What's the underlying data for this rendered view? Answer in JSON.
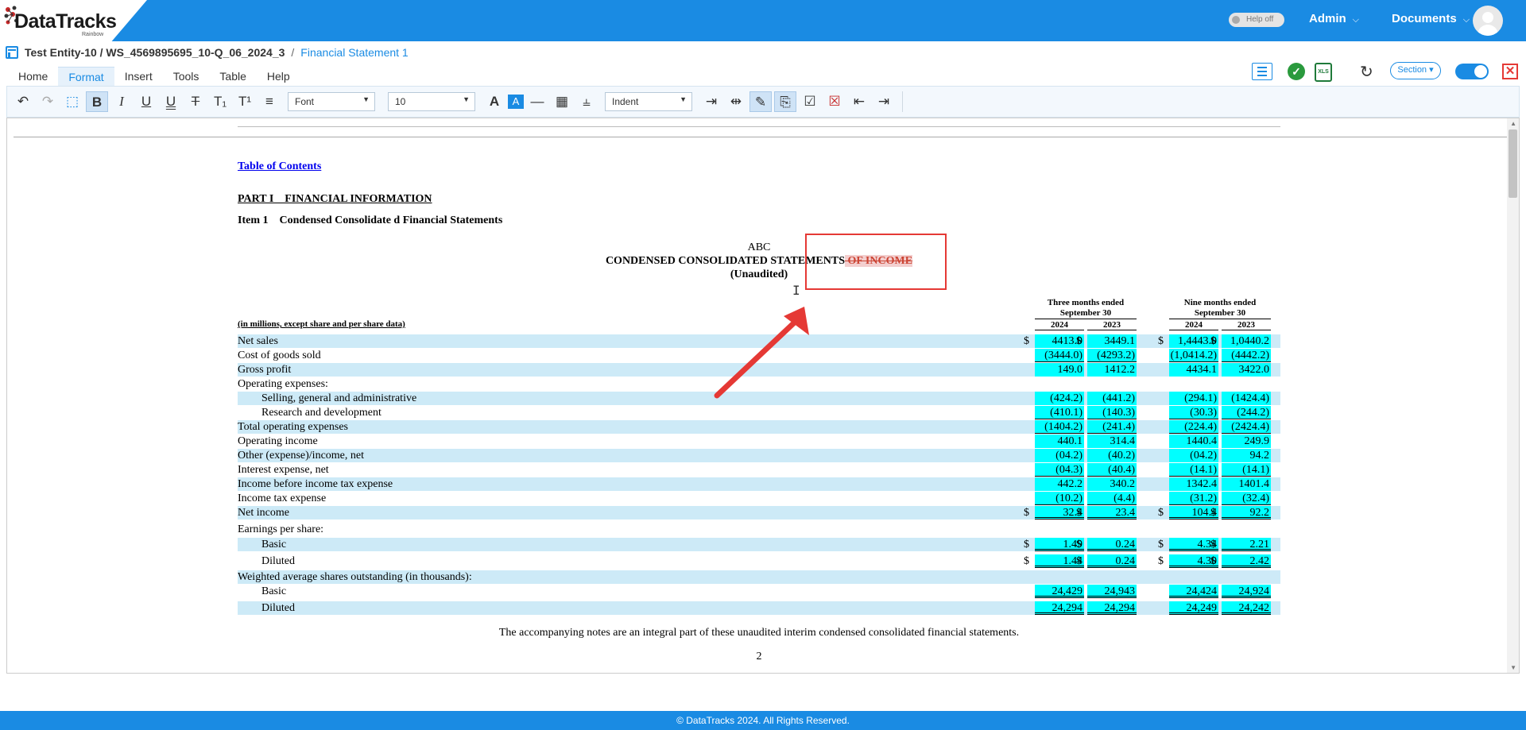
{
  "app": {
    "logo_text": "DataTracks",
    "logo_sub": "Rainbow",
    "help_toggle": "Help off",
    "nav": [
      {
        "label": "Admin"
      },
      {
        "label": "Documents"
      }
    ]
  },
  "breadcrumb": {
    "path": "Test Entity-10 / WS_4569895695_10-Q_06_2024_3",
    "separator": "/",
    "current": "Financial Statement 1"
  },
  "menu": [
    "Home",
    "Format",
    "Insert",
    "Tools",
    "Table",
    "Help"
  ],
  "menu_active": "Format",
  "header_controls": {
    "section_label": "Section",
    "xls_label": "XLS"
  },
  "toolbar": {
    "font_select": "Font",
    "size_select": "10",
    "indent_select": "Indent"
  },
  "document": {
    "toc_link": "Table of Contents",
    "part_heading": "PART I    FINANCIAL INFORMATION",
    "item_heading": "Item 1    Condensed Consolidate d Financial Statements",
    "company": "ABC",
    "title_main": "CONDENSED CONSOLIDATED STATEMENTS",
    "title_deleted": " OF INCOME",
    "title_sub": "(Unaudited)",
    "units_note": "(in millions, except share and per share data)",
    "col_groups": [
      "Three months ended September 30",
      "Nine months ended September 30"
    ],
    "years": [
      "2024",
      "2023",
      "2024",
      "2023"
    ],
    "rows": [
      {
        "label": "Net sales",
        "values": [
          "4413.0",
          "3449.1",
          "1,4443.0",
          "1,0440.2"
        ],
        "dollar": true,
        "hl": true
      },
      {
        "label": "Cost of goods sold",
        "values": [
          "(3444.0)",
          "(4293.2)",
          "(1,0414.2)",
          "(4442.2)"
        ],
        "ul": true
      },
      {
        "label": "Gross profit",
        "values": [
          "149.0",
          "1412.2",
          "4434.1",
          "3422.0"
        ],
        "hl": true
      },
      {
        "label": "Operating expenses:",
        "values": []
      },
      {
        "label": "Selling, general and administrative",
        "values": [
          "(424.2)",
          "(441.2)",
          "(294.1)",
          "(1424.4)"
        ],
        "indent": true,
        "hl": true
      },
      {
        "label": "Research and development",
        "values": [
          "(410.1)",
          "(140.3)",
          "(30.3)",
          "(244.2)"
        ],
        "indent": true,
        "ul": true
      },
      {
        "label": "Total operating expenses",
        "values": [
          "(1404.2)",
          "(241.4)",
          "(224.4)",
          "(2424.4)"
        ],
        "hl": true,
        "ul": true
      },
      {
        "label": "Operating income",
        "values": [
          "440.1",
          "314.4",
          "1440.4",
          "249.9"
        ]
      },
      {
        "label": "Other (expense)/income, net",
        "values": [
          "(04.2)",
          "(40.2)",
          "(04.2)",
          "94.2"
        ],
        "hl": true
      },
      {
        "label": "Interest expense, net",
        "values": [
          "(04.3)",
          "(40.4)",
          "(14.1)",
          "(14.1)"
        ],
        "ul": true
      },
      {
        "label": "Income before income tax expense",
        "values": [
          "442.2",
          "340.2",
          "1342.4",
          "1401.4"
        ],
        "hl": true
      },
      {
        "label": "Income tax expense",
        "values": [
          "(10.2)",
          "(4.4)",
          "(31.2)",
          "(32.4)"
        ],
        "ul": true
      },
      {
        "label": "Net income",
        "values": [
          "32.4",
          "23.4",
          "104.4",
          "92.2"
        ],
        "dollar": true,
        "dbl": true,
        "hl": true
      },
      {
        "label": "Earnings per share:",
        "values": []
      },
      {
        "label": "Basic",
        "values": [
          "1.49",
          "0.24",
          "4.34",
          "2.21"
        ],
        "indent": true,
        "dollar": true,
        "dbl": true,
        "hl": true
      },
      {
        "label": "Diluted",
        "values": [
          "1.44",
          "0.24",
          "4.30",
          "2.42"
        ],
        "indent": true,
        "dollar": true,
        "dbl": true
      },
      {
        "label": "Weighted average shares outstanding (in thousands):",
        "values": [],
        "hl": true
      },
      {
        "label": "Basic",
        "values": [
          "24,429",
          "24,943",
          "24,424",
          "24,924"
        ],
        "indent": true,
        "dbl": true
      },
      {
        "label": "Diluted",
        "values": [
          "24,294",
          "24,294",
          "24,249",
          "24,242"
        ],
        "indent": true,
        "dbl": true,
        "hl": true
      }
    ],
    "footnote": "The accompanying notes are an integral part of these unaudited interim condensed consolidated financial statements.",
    "page_number": "2"
  },
  "footer": "© DataTracks 2024. All Rights Reserved.",
  "colors": {
    "brand_blue": "#1a8be3",
    "highlight_cyan": "#00ffff",
    "row_highlight": "#cdeaf7",
    "annotation_red": "#e53935"
  }
}
